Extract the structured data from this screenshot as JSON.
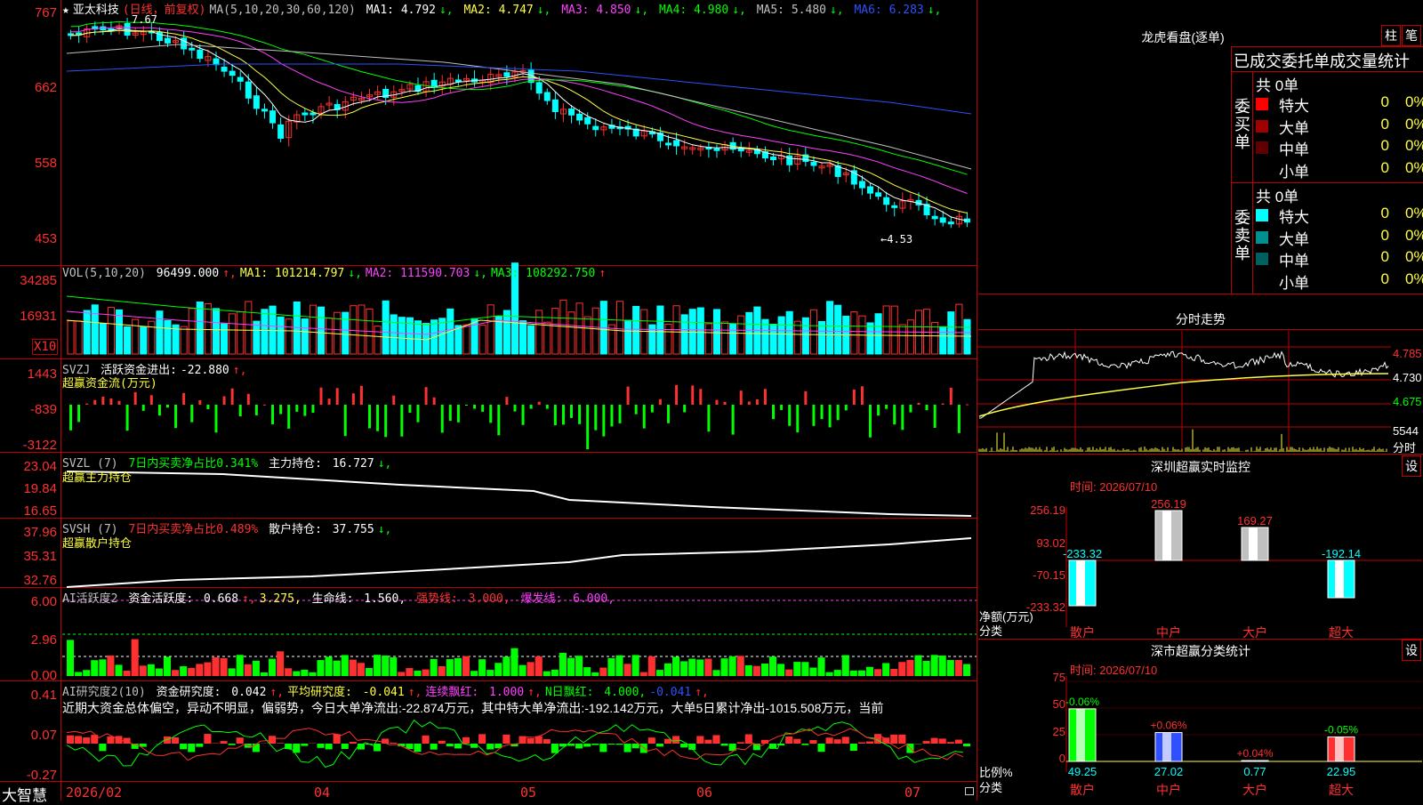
{
  "stock": {
    "star": "★",
    "name": "亚太科技",
    "period": "(日线，前复权)",
    "ma_label": "MA(5,10,20,30,60,120)",
    "ma_values": [
      {
        "label": "MA1:",
        "value": "4.792",
        "arrow": "↓",
        "color": "#ffffff"
      },
      {
        "label": "MA2:",
        "value": "4.747",
        "arrow": "↓",
        "color": "#ffff40"
      },
      {
        "label": "MA3:",
        "value": "4.850",
        "arrow": "↓",
        "color": "#ff40ff"
      },
      {
        "label": "MA4:",
        "value": "4.980",
        "arrow": "↓",
        "color": "#00ff00"
      },
      {
        "label": "MA5:",
        "value": "5.480",
        "arrow": "↓",
        "color": "#c0c0c0"
      },
      {
        "label": "MA6:",
        "value": "6.283",
        "arrow": "↓",
        "color": "#3050ff"
      }
    ],
    "high_mark": "7.67",
    "low_mark": "←4.53"
  },
  "price_ticks": [
    "767",
    "662",
    "558",
    "453"
  ],
  "vol": {
    "label": "VOL(5,10,20)",
    "value": "96499.000",
    "ma1": "MA1: 101214.797",
    "ma2": "MA2: 111590.703",
    "ma3": "MA3: 108292.750",
    "ticks": [
      "34285",
      "16931"
    ],
    "unit": "X10"
  },
  "svzj": {
    "label": "SVZJ",
    "title": "活跃资金进出:",
    "value": "-22.880",
    "sub": "超赢资金流(万元)",
    "ticks": [
      "1443",
      "-839",
      "-3122"
    ]
  },
  "svzl": {
    "label": "SVZL (7)",
    "text1": "7日内买卖净占比0.341%",
    "text2": "主力持仓:",
    "value": "16.727",
    "sub": "超赢主力持仓",
    "ticks": [
      "23.04",
      "19.84",
      "16.65"
    ]
  },
  "svsh": {
    "label": "SVSH (7)",
    "text1": "7日内买卖净占比0.489%",
    "text2": "散户持仓:",
    "value": "37.755",
    "sub": "超赢散户持仓",
    "ticks": [
      "37.96",
      "35.31",
      "32.76"
    ]
  },
  "ai_active": {
    "label": "AI活跃度2",
    "t1": "资金活跃度:",
    "v1": "0.668",
    "v2": "3.275,",
    "t3": "生命线:",
    "v3": "1.560,",
    "t4": "强势线:",
    "v4": "3.000,",
    "t5": "爆发线:",
    "v5": "6.000,",
    "ticks": [
      "6.00",
      "2.96",
      "0.00"
    ]
  },
  "ai_research": {
    "label": "AI研究度2(10)",
    "t1": "资金研究度:",
    "v1": "0.042",
    "t2": "平均研究度:",
    "v2": "-0.041",
    "t3": "连续飘红:",
    "v3": "1.000",
    "t4": "N日飘红:",
    "v4": "4.000,",
    "v5": "-0.041",
    "summary": "近期大资金总体偏空，异动不明显，偏弱势，今日大单净流出:-22.874万元，其中特大单净流出:-192.142万元，大单5日累计净出-1015.508万元，当前",
    "ticks": [
      "0.41",
      "0.07",
      "-0.27"
    ]
  },
  "xaxis": {
    "brand": "大智慧",
    "labels": [
      "2026/02",
      "04",
      "05",
      "06",
      "07"
    ]
  },
  "longhu": {
    "title": "龙虎看盘(逐单)",
    "btn1": "柱",
    "btn2": "笔",
    "subtitle": "已成交委托单成交量统计",
    "buy_label": "委买单",
    "sell_label": "委卖单",
    "buy_total": "共 0单",
    "sell_total": "共 0单",
    "buy_rows": [
      {
        "label": "特大",
        "count": "0",
        "pct": "0%",
        "color": "#ff0000"
      },
      {
        "label": "大单",
        "count": "0",
        "pct": "0%",
        "color": "#a00000"
      },
      {
        "label": "中单",
        "count": "0",
        "pct": "0%",
        "color": "#600000"
      },
      {
        "label": "小单",
        "count": "0",
        "pct": "0%",
        "color": "#000000"
      }
    ],
    "sell_rows": [
      {
        "label": "特大",
        "count": "0",
        "pct": "0%",
        "color": "#00ffff"
      },
      {
        "label": "大单",
        "count": "0",
        "pct": "0%",
        "color": "#009090"
      },
      {
        "label": "中单",
        "count": "0",
        "pct": "0%",
        "color": "#006060"
      },
      {
        "label": "小单",
        "count": "0",
        "pct": "0%",
        "color": "#000000"
      }
    ]
  },
  "intraday": {
    "title": "分时走势",
    "ticks": [
      "4.785",
      "4.730",
      "4.675"
    ],
    "vol_tick": "5544",
    "vol_unit": "分时"
  },
  "sz_monitor": {
    "title": "深圳超赢实时监控",
    "set": "设",
    "time": "时间: 2026/07/10",
    "ticks": [
      "256.19",
      "93.02",
      "-70.15",
      "-233.32"
    ],
    "ylabel1": "净额(万元)",
    "ylabel2": "分类",
    "bars": [
      {
        "cat": "散户",
        "value": "-233.32",
        "num": -233.32,
        "color": "#00ffff"
      },
      {
        "cat": "中户",
        "value": "256.19",
        "num": 256.19,
        "color": "#c0c0c0"
      },
      {
        "cat": "大户",
        "value": "169.27",
        "num": 169.27,
        "color": "#c0c0c0"
      },
      {
        "cat": "超大",
        "value": "-192.14",
        "num": -192.14,
        "color": "#00ffff"
      }
    ]
  },
  "sz_stats": {
    "title": "深市超赢分类统计",
    "set": "设",
    "time": "时间: 2026/07/10",
    "ticks": [
      "75",
      "50",
      "25",
      "0"
    ],
    "ylabel1": "比例%",
    "ylabel2": "分类",
    "bars": [
      {
        "cat": "散户",
        "top": "-0.06%",
        "bottom": "49.25",
        "num": 49.25,
        "color": "#00ff00"
      },
      {
        "cat": "中户",
        "top": "+0.06%",
        "bottom": "27.02",
        "num": 27.02,
        "color": "#3050ff"
      },
      {
        "cat": "大户",
        "top": "+0.04%",
        "bottom": "0.77",
        "num": 0.77,
        "color": "#ff3030"
      },
      {
        "cat": "超大",
        "top": "-0.05%",
        "bottom": "22.95",
        "num": 22.95,
        "color": "#ff3030"
      }
    ]
  }
}
